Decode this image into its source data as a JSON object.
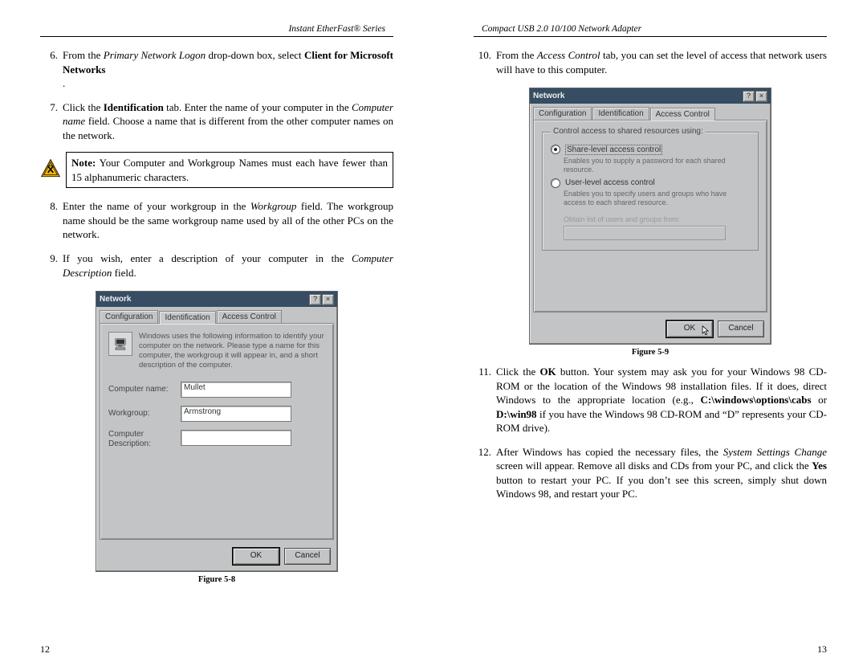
{
  "header_left": "Instant EtherFast® Series",
  "header_right": "Compact USB 2.0 10/100 Network Adapter",
  "page_left_num": "12",
  "page_right_num": "13",
  "steps_left": {
    "s6": {
      "num": "6.",
      "pre": "From the ",
      "i1": "Primary Network Logon",
      "mid": " drop-down box, select ",
      "b1": "Client for Microsoft Networks",
      "post": "."
    },
    "s7": {
      "num": "7.",
      "pre": "Click the ",
      "b1": "Identification",
      "mid": " tab. Enter the name of your computer in the ",
      "i1": "Computer name",
      "post": " field. Choose a name that is different from the other computer names on the network."
    },
    "note": {
      "lead": "Note:",
      "body": " Your Computer and Workgroup Names must each have fewer than 15 alphanumeric characters."
    },
    "s8": {
      "num": "8.",
      "pre": "Enter the name of your workgroup in the ",
      "i1": "Workgroup",
      "post": " field. The workgroup name should be the same workgroup name used by all of the other PCs on the network."
    },
    "s9": {
      "num": "9.",
      "pre": "If you wish, enter a description of your computer in the ",
      "i1": "Computer Description",
      "post": " field."
    }
  },
  "steps_right": {
    "s10": {
      "num": "10.",
      "pre": "From the ",
      "i1": "Access Control",
      "post": " tab, you can set the level of access that network users will have to this computer."
    },
    "s11": {
      "num": "11.",
      "pre": "Click the ",
      "b1": "OK",
      "mid1": " button. Your system may ask you for your Windows 98 CD-ROM or the location of the Windows 98 installation files. If it does, direct Windows to the appropriate location (e.g., ",
      "b2": "C:\\windows\\options\\cabs",
      "mid2": " or ",
      "b3": "D:\\win98",
      "post": " if you have the Windows 98 CD-ROM and “D” represents your CD-ROM drive)."
    },
    "s12": {
      "num": "12.",
      "pre": "After Windows has copied the necessary files, the ",
      "i1": "System Settings Change",
      "mid": " screen will appear. Remove all disks and CDs from your PC, and click the ",
      "b1": "Yes",
      "post": " button to restart your PC. If you don’t see this screen, simply shut down Windows 98, and restart your PC."
    }
  },
  "fig58_caption": "Figure 5-8",
  "fig59_caption": "Figure 5-9",
  "dialog_identification": {
    "title": "Network",
    "tabs": {
      "config": "Configuration",
      "ident": "Identification",
      "access": "Access Control"
    },
    "hint": "Windows uses the following information to identify your computer on the network.  Please type a name for this computer, the workgroup it will appear in, and a short description of the computer.",
    "labels": {
      "name": "Computer name:",
      "wg": "Workgroup:",
      "desc": "Computer Description:"
    },
    "values": {
      "name": "Mullet",
      "wg": "Armstrong",
      "desc": ""
    },
    "ok": "OK",
    "cancel": "Cancel"
  },
  "dialog_access": {
    "title": "Network",
    "tabs": {
      "config": "Configuration",
      "ident": "Identification",
      "access": "Access Control"
    },
    "legend": "Control access to shared resources using:",
    "opt1": "Share-level access control",
    "opt1desc": "Enables you to supply a password for each shared resource.",
    "opt2": "User-level access control",
    "opt2desc": "Enables you to specify users and groups who have access to each shared resource.",
    "disabled_label": "Obtain list of users and groups from:",
    "ok": "OK",
    "cancel": "Cancel"
  }
}
